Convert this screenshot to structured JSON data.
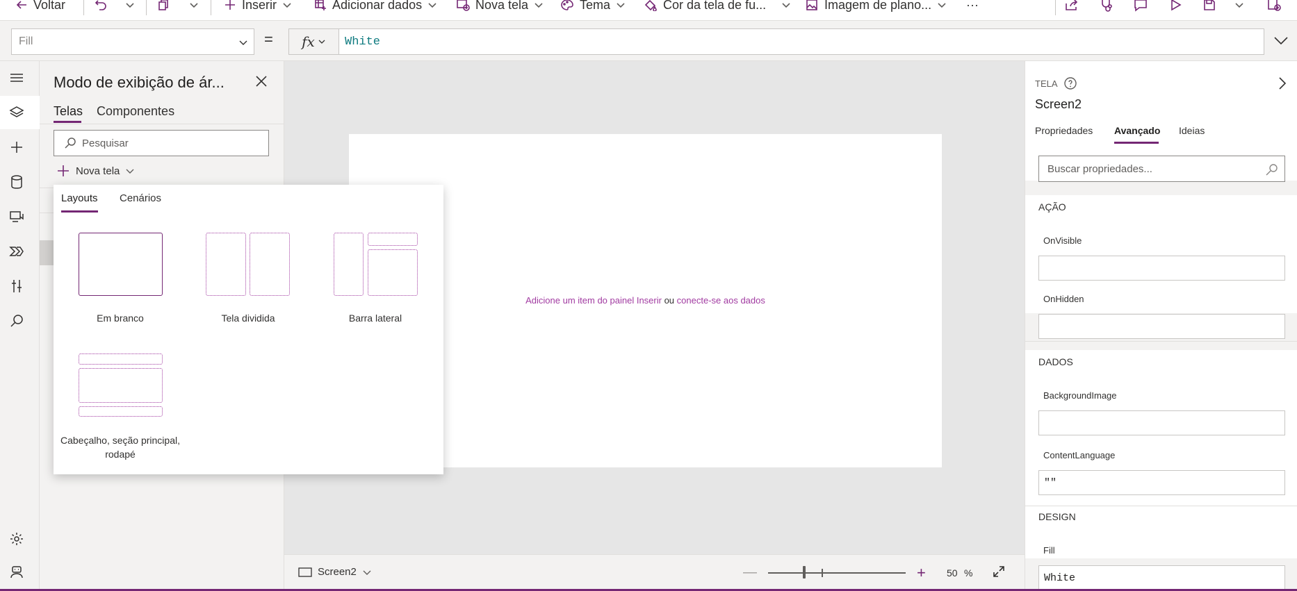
{
  "toolbar": {
    "back": "Voltar",
    "insert": "Inserir",
    "add_data": "Adicionar dados",
    "new_screen": "Nova tela",
    "theme": "Tema",
    "bg_color": "Cor da tela de fu...",
    "bg_image": "Imagem de plano...",
    "more": "···"
  },
  "formula": {
    "property": "Fill",
    "equals": "=",
    "fx": "fx",
    "value": "White"
  },
  "tree": {
    "title": "Modo de exibição de ár...",
    "tab_screens": "Telas",
    "tab_components": "Componentes",
    "search_placeholder": "Pesquisar",
    "new_screen": "Nova tela"
  },
  "popup": {
    "tab_layouts": "Layouts",
    "tab_scenarios": "Cenários",
    "layouts": [
      {
        "label": "Em branco"
      },
      {
        "label": "Tela dividida"
      },
      {
        "label": "Barra lateral"
      },
      {
        "label": "Cabeçalho, seção principal, rodapé"
      }
    ]
  },
  "canvas": {
    "hint_link1": "Adicione um item do painel Inserir",
    "hint_or": "ou",
    "hint_link2": "conecte-se aos dados",
    "footer_screen": "Screen2",
    "zoom_value": "50",
    "zoom_unit": "%"
  },
  "properties": {
    "kind": "TELA",
    "name": "Screen2",
    "tabs": [
      "Propriedades",
      "Avançado",
      "Ideias"
    ],
    "active_tab": "Avançado",
    "search_placeholder": "Buscar propriedades...",
    "sections": {
      "action": "AÇÃO",
      "data": "DADOS",
      "design": "DESIGN"
    },
    "fields": {
      "on_visible": {
        "label": "OnVisible",
        "value": ""
      },
      "on_hidden": {
        "label": "OnHidden",
        "value": ""
      },
      "background_image": {
        "label": "BackgroundImage",
        "value": ""
      },
      "content_language": {
        "label": "ContentLanguage",
        "value": "\"\""
      },
      "fill": {
        "label": "Fill",
        "value": "White"
      }
    }
  },
  "colors": {
    "accent": "#742774",
    "link": "#a13ba1",
    "formula_text": "#0f7b80"
  }
}
